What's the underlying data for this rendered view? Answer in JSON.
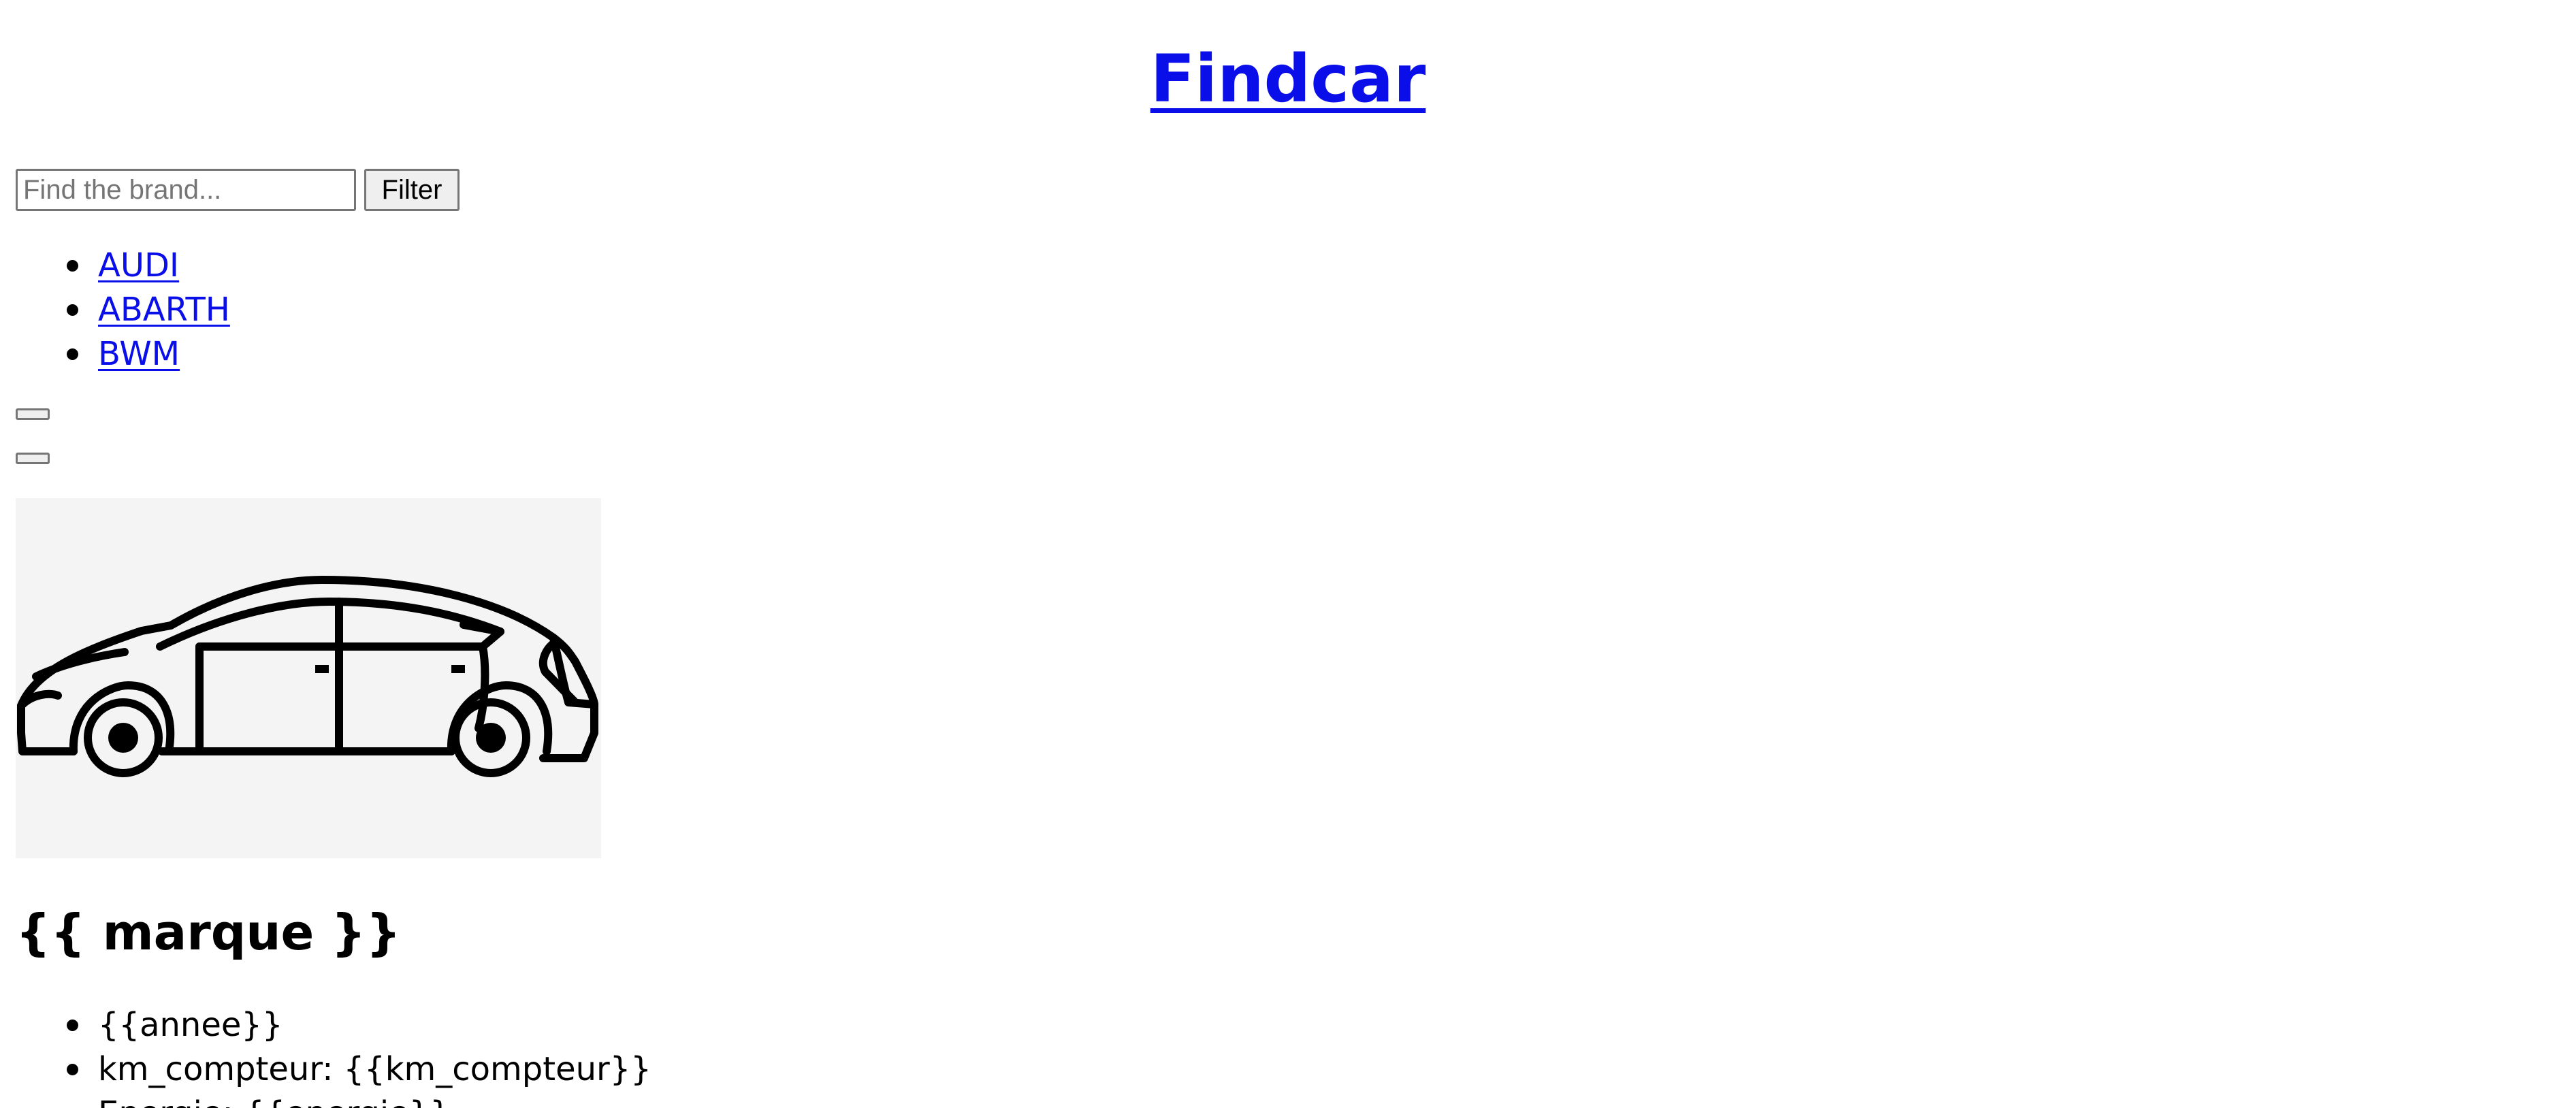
{
  "header": {
    "title": "Findcar"
  },
  "search": {
    "placeholder": "Find the brand...",
    "value": "",
    "filter_label": "Filter"
  },
  "brands": [
    {
      "label": "AUDI"
    },
    {
      "label": "ABARTH"
    },
    {
      "label": "BWM"
    }
  ],
  "buttons": {
    "button_1_label": "",
    "button_2_label": ""
  },
  "card": {
    "image_icon": "car-side-icon",
    "title": "{{ marque }}",
    "details": [
      {
        "text": "{{annee}}"
      },
      {
        "text": "km_compteur: {{km_compteur}}"
      },
      {
        "text": "Energie: {{energie}}"
      }
    ]
  },
  "colors": {
    "link": "#0a0ee8",
    "text": "#000000",
    "image_background": "#f4f4f4"
  }
}
